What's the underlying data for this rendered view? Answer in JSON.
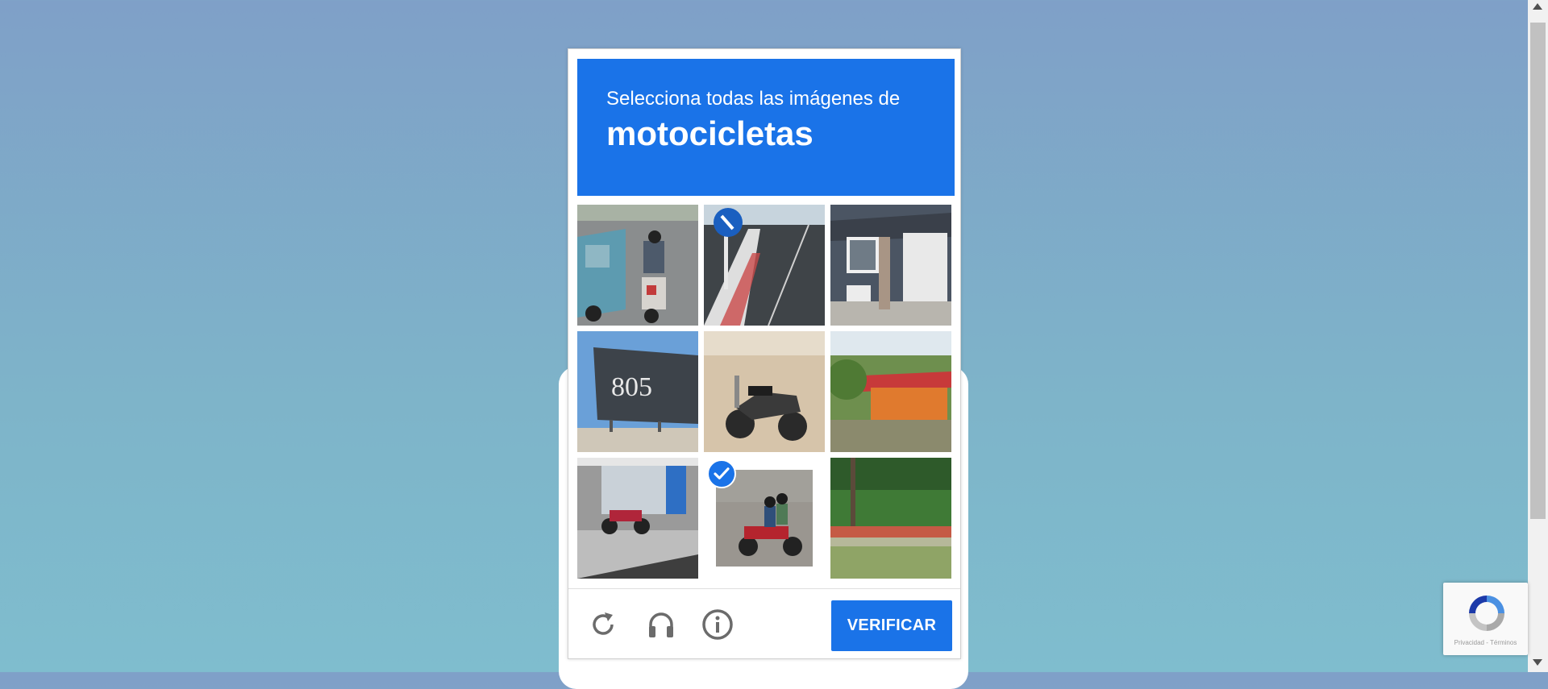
{
  "challenge": {
    "prompt_lead": "Selecciona todas las imágenes de",
    "prompt_target": "motocicletas",
    "tiles": [
      {
        "subject": "van and motorcyclist on street",
        "selected": false
      },
      {
        "subject": "road with blue sign and striped curb",
        "selected": false
      },
      {
        "subject": "grey house with white garage",
        "selected": false
      },
      {
        "subject": "805 billboard",
        "selected": false
      },
      {
        "subject": "parked motorcycle on sand",
        "selected": false
      },
      {
        "subject": "orange house with red roof",
        "selected": false
      },
      {
        "subject": "motorcycle parked by storefront",
        "selected": false
      },
      {
        "subject": "riders on red motorcycle",
        "selected": true
      },
      {
        "subject": "green hedge and grass",
        "selected": false
      }
    ]
  },
  "footer": {
    "reload_icon": "reload-icon",
    "audio_icon": "headphones-icon",
    "info_icon": "info-icon",
    "verify_label": "VERIFICAR"
  },
  "badge": {
    "privacy_label": "Privacidad",
    "separator": " - ",
    "terms_label": "Términos"
  },
  "colors": {
    "accent": "#1a73e8",
    "page_background_top": "#7fa0c8",
    "page_background_bottom": "#7fbdce"
  }
}
